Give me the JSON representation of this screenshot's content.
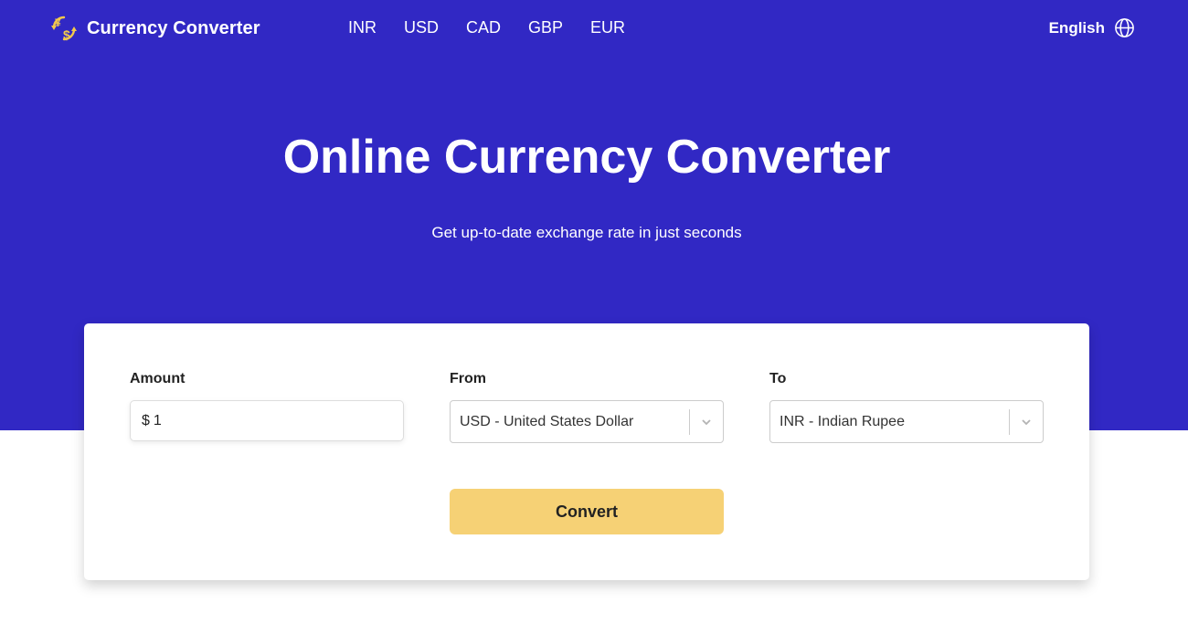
{
  "header": {
    "brand_name": "Currency Converter",
    "brand_icon": "currency-exchange-icon",
    "nav_links": [
      "INR",
      "USD",
      "CAD",
      "GBP",
      "EUR"
    ],
    "language_label": "English",
    "language_icon": "globe-icon"
  },
  "hero": {
    "title": "Online Currency Converter",
    "subtitle": "Get up-to-date exchange rate in just seconds"
  },
  "form": {
    "amount": {
      "label": "Amount",
      "prefix": "$",
      "value": "1"
    },
    "from": {
      "label": "From",
      "value": "USD - United States Dollar"
    },
    "to": {
      "label": "To",
      "value": "INR - Indian Rupee"
    },
    "convert_label": "Convert"
  },
  "colors": {
    "hero_bg": "#3128c4",
    "button_bg": "#f6d175",
    "brand_icon": "#f2c94c"
  }
}
